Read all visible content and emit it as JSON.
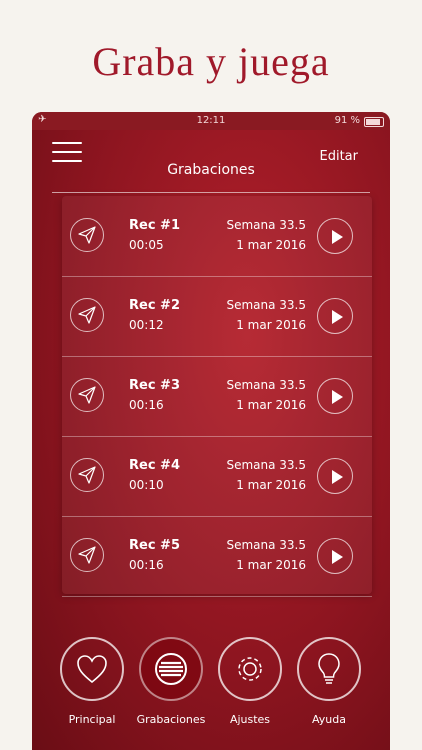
{
  "headline": "Graba y juega",
  "status": {
    "time": "12:11",
    "battery": "91 %"
  },
  "header": {
    "title": "Grabaciones",
    "edit_label": "Editar"
  },
  "recordings": [
    {
      "name": "Rec #1",
      "duration": "00:05",
      "week": "Semana 33.5",
      "date": "1 mar 2016"
    },
    {
      "name": "Rec #2",
      "duration": "00:12",
      "week": "Semana 33.5",
      "date": "1 mar 2016"
    },
    {
      "name": "Rec #3",
      "duration": "00:16",
      "week": "Semana 33.5",
      "date": "1 mar 2016"
    },
    {
      "name": "Rec #4",
      "duration": "00:10",
      "week": "Semana 33.5",
      "date": "1 mar 2016"
    },
    {
      "name": "Rec #5",
      "duration": "00:16",
      "week": "Semana 33.5",
      "date": "1 mar 2016"
    }
  ],
  "tabs": [
    {
      "label": "Principal",
      "icon": "heart-icon"
    },
    {
      "label": "Grabaciones",
      "icon": "recordings-icon",
      "active": true
    },
    {
      "label": "Ajustes",
      "icon": "gear-icon"
    },
    {
      "label": "Ayuda",
      "icon": "lightbulb-icon"
    }
  ],
  "colors": {
    "headline": "#a0192a",
    "phone_bg": "#8e1520",
    "page_bg": "#f6f3ee"
  }
}
